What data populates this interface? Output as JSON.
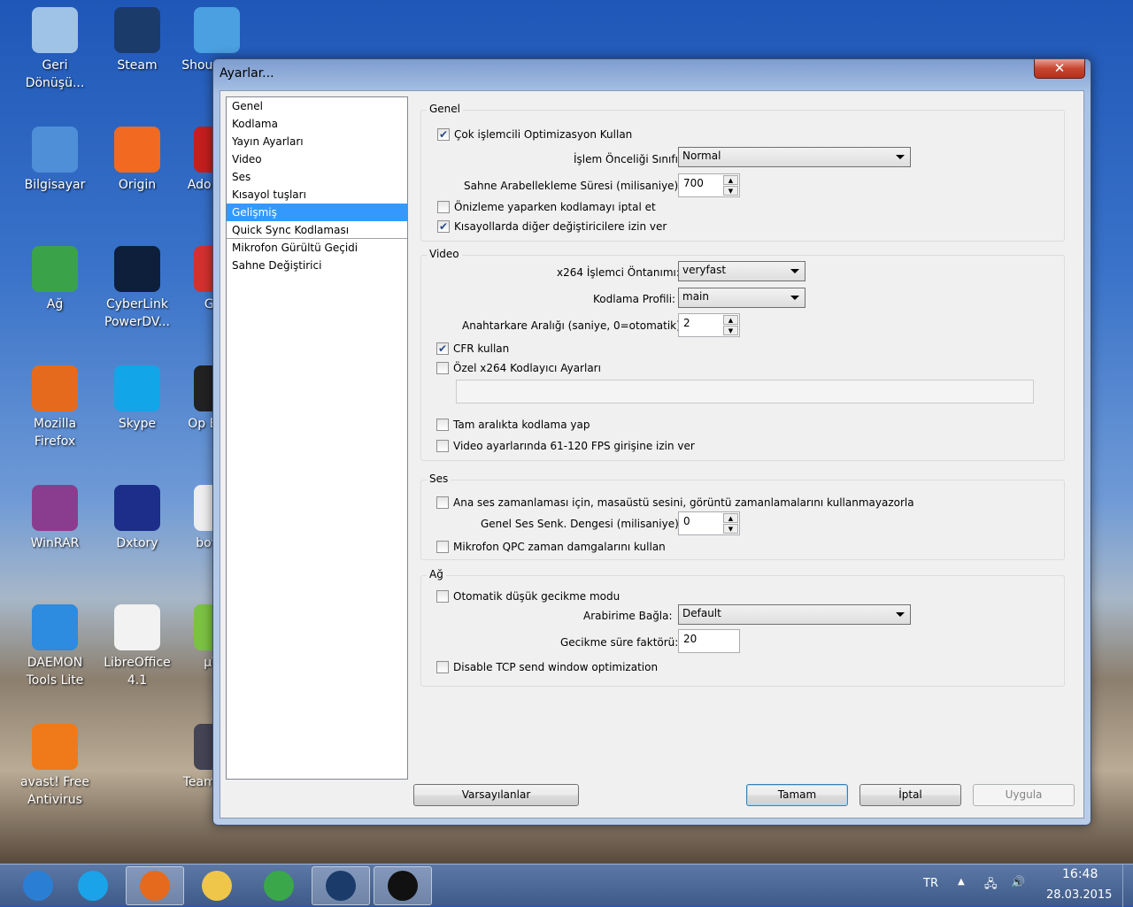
{
  "desktop": {
    "icons": [
      {
        "label": "Geri Dönüşü...",
        "color": "#9fc3e6"
      },
      {
        "label": "Bilgisayar",
        "color": "#4f8fd8"
      },
      {
        "label": "Ağ",
        "color": "#3aa34a"
      },
      {
        "label": "Mozilla Firefox",
        "color": "#e66a1d"
      },
      {
        "label": "WinRAR",
        "color": "#8a3d8f"
      },
      {
        "label": "DAEMON Tools Lite",
        "color": "#2d8be0"
      },
      {
        "label": "avast! Free Antivirus",
        "color": "#f07a1a"
      },
      {
        "label": "Steam",
        "color": "#1b3b6b"
      },
      {
        "label": "Origin",
        "color": "#f26a21"
      },
      {
        "label": "CyberLink PowerDV...",
        "color": "#0d1f3a"
      },
      {
        "label": "Skype",
        "color": "#12a5e8"
      },
      {
        "label": "Dxtory",
        "color": "#1c2d8a"
      },
      {
        "label": "LibreOffice 4.1",
        "color": "#f2f2f2"
      },
      {
        "label": "Shou Remo",
        "color": "#4aa0e0"
      },
      {
        "label": "Ado Read",
        "color": "#c41e1e"
      },
      {
        "label": "Gan",
        "color": "#d43030"
      },
      {
        "label": "Op Broad",
        "color": "#222"
      },
      {
        "label": "boykot",
        "color": "#eee"
      },
      {
        "label": "µTor",
        "color": "#7cc242"
      },
      {
        "label": "TeamS Clie",
        "color": "#445"
      }
    ]
  },
  "dialog": {
    "title": "Ayarlar...",
    "close": "✕",
    "nav": [
      "Genel",
      "Kodlama",
      "Yayın Ayarları",
      "Video",
      "Ses",
      "Kısayol tuşları",
      "Gelişmiş",
      "Quick Sync Kodlaması",
      "Mikrofon Gürültü Geçidi",
      "Sahne Değiştirici"
    ],
    "selected_nav": "Gelişmiş",
    "general": {
      "title": "Genel",
      "multicore": "Çok işlemcili Optimizasyon Kullan",
      "multicore_checked": true,
      "priority_label": "İşlem Önceliği Sınıfı",
      "priority_value": "Normal",
      "buffer_label": "Sahne Arabellekleme Süresi (milisaniye):",
      "buffer_value": "700",
      "preview_disable": "Önizleme yaparken kodlamayı iptal et",
      "preview_disable_checked": false,
      "hotkeys_modifiers": "Kısayollarda diğer değiştiricilere izin ver",
      "hotkeys_modifiers_checked": true
    },
    "video": {
      "title": "Video",
      "preset_label": "x264 İşlemci Öntanımı:",
      "preset_value": "veryfast",
      "profile_label": "Kodlama Profili:",
      "profile_value": "main",
      "keyframe_label": "Anahtarkare Aralığı (saniye, 0=otomatik):",
      "keyframe_value": "2",
      "cfr": "CFR kullan",
      "cfr_checked": true,
      "custom_x264": "Özel x264 Kodlayıcı Ayarları",
      "custom_x264_checked": false,
      "custom_x264_value": "",
      "full_range": "Tam aralıkta kodlama yap",
      "full_range_checked": false,
      "fps_120": "Video ayarlarında 61-120 FPS girişine izin ver",
      "fps_120_checked": false
    },
    "audio": {
      "title": "Ses",
      "desktop_timing": "Ana ses zamanlaması için, masaüstü sesini, görüntü zamanlamalarını kullanmayazorla",
      "desktop_timing_checked": false,
      "sync_label": "Genel Ses Senk. Dengesi (milisaniye):",
      "sync_value": "0",
      "mic_qpc": "Mikrofon QPC zaman damgalarını kullan",
      "mic_qpc_checked": false
    },
    "network": {
      "title": "Ağ",
      "low_latency": "Otomatik düşük gecikme modu",
      "low_latency_checked": false,
      "bind_label": "Arabirime Bağla:",
      "bind_value": "Default",
      "latency_label": "Gecikme süre faktörü:",
      "latency_value": "20",
      "tcp": "Disable TCP send window optimization",
      "tcp_checked": false
    },
    "buttons": {
      "defaults": "Varsayılanlar",
      "ok": "Tamam",
      "cancel": "İptal",
      "apply": "Uygula"
    }
  },
  "taskbar": {
    "apps": [
      {
        "name": "start",
        "color": "#2a7fd4"
      },
      {
        "name": "internet-explorer",
        "color": "#1aa3e8"
      },
      {
        "name": "firefox",
        "color": "#e66a1d"
      },
      {
        "name": "explorer",
        "color": "#f0c64a"
      },
      {
        "name": "chrome",
        "color": "#3aa84a"
      },
      {
        "name": "steam",
        "color": "#1b3b6b"
      },
      {
        "name": "obs",
        "color": "#111"
      }
    ],
    "lang": "TR",
    "time": "16:48",
    "date": "28.03.2015"
  }
}
